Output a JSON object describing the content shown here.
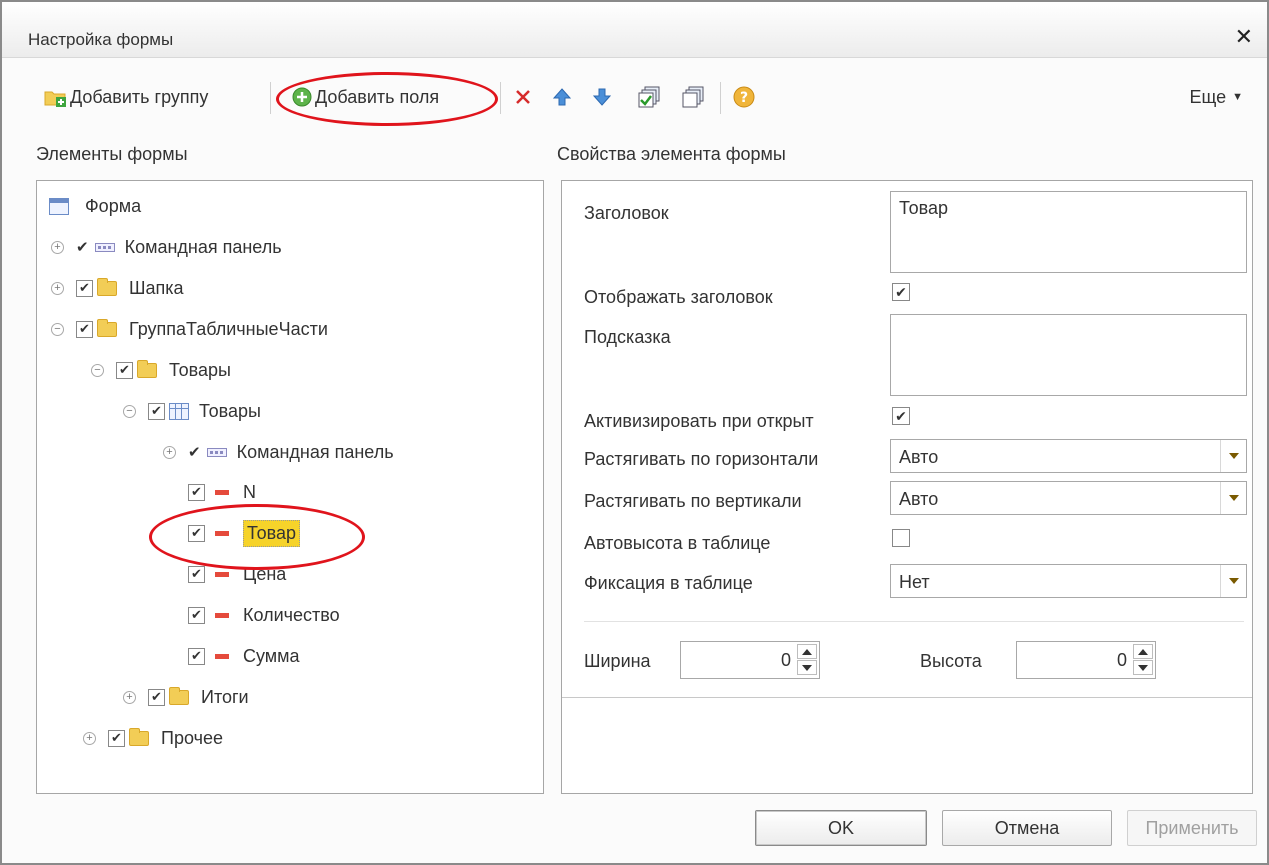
{
  "window": {
    "title": "Настройка формы"
  },
  "toolbar": {
    "add_group_label": "Добавить группу",
    "add_fields_label": "Добавить поля",
    "more_label": "Еще",
    "icons": [
      "add-group-icon",
      "add-fields-icon",
      "delete-icon",
      "move-up-icon",
      "move-down-icon",
      "check-all-icon",
      "uncheck-all-icon",
      "help-icon"
    ]
  },
  "tree": {
    "title": "Элементы формы",
    "items": [
      {
        "label": "Форма"
      },
      {
        "label": "Командная панель"
      },
      {
        "label": "Шапка"
      },
      {
        "label": "ГруппаТабличныеЧасти"
      },
      {
        "label": "Товары"
      },
      {
        "label": "Товары"
      },
      {
        "label": "Командная панель"
      },
      {
        "label": "N"
      },
      {
        "label": "Товар"
      },
      {
        "label": "Цена"
      },
      {
        "label": "Количество"
      },
      {
        "label": "Сумма"
      },
      {
        "label": "Итоги"
      },
      {
        "label": "Прочее"
      }
    ]
  },
  "props": {
    "title": "Свойства элемента формы",
    "header_label": "Заголовок",
    "header_value": "Товар",
    "show_header_label": "Отображать заголовок",
    "show_header_checked": true,
    "tooltip_label": "Подсказка",
    "tooltip_value": "",
    "activate_label": "Активизировать при открыт",
    "activate_checked": true,
    "stretch_h_label": "Растягивать по горизонтали",
    "stretch_h_value": "Авто",
    "stretch_v_label": "Растягивать по вертикали",
    "stretch_v_value": "Авто",
    "auto_height_label": "Автовысота в таблице",
    "auto_height_checked": false,
    "fix_label": "Фиксация в таблице",
    "fix_value": "Нет",
    "width_label": "Ширина",
    "width_value": "0",
    "height_label": "Высота",
    "height_value": "0"
  },
  "buttons": {
    "ok": "OK",
    "cancel": "Отмена",
    "apply": "Применить"
  },
  "colors": {
    "annotation": "#e0141c",
    "selection": "#f6d32a",
    "field_marker": "#e54a3c",
    "folder": "#f2cd56"
  }
}
